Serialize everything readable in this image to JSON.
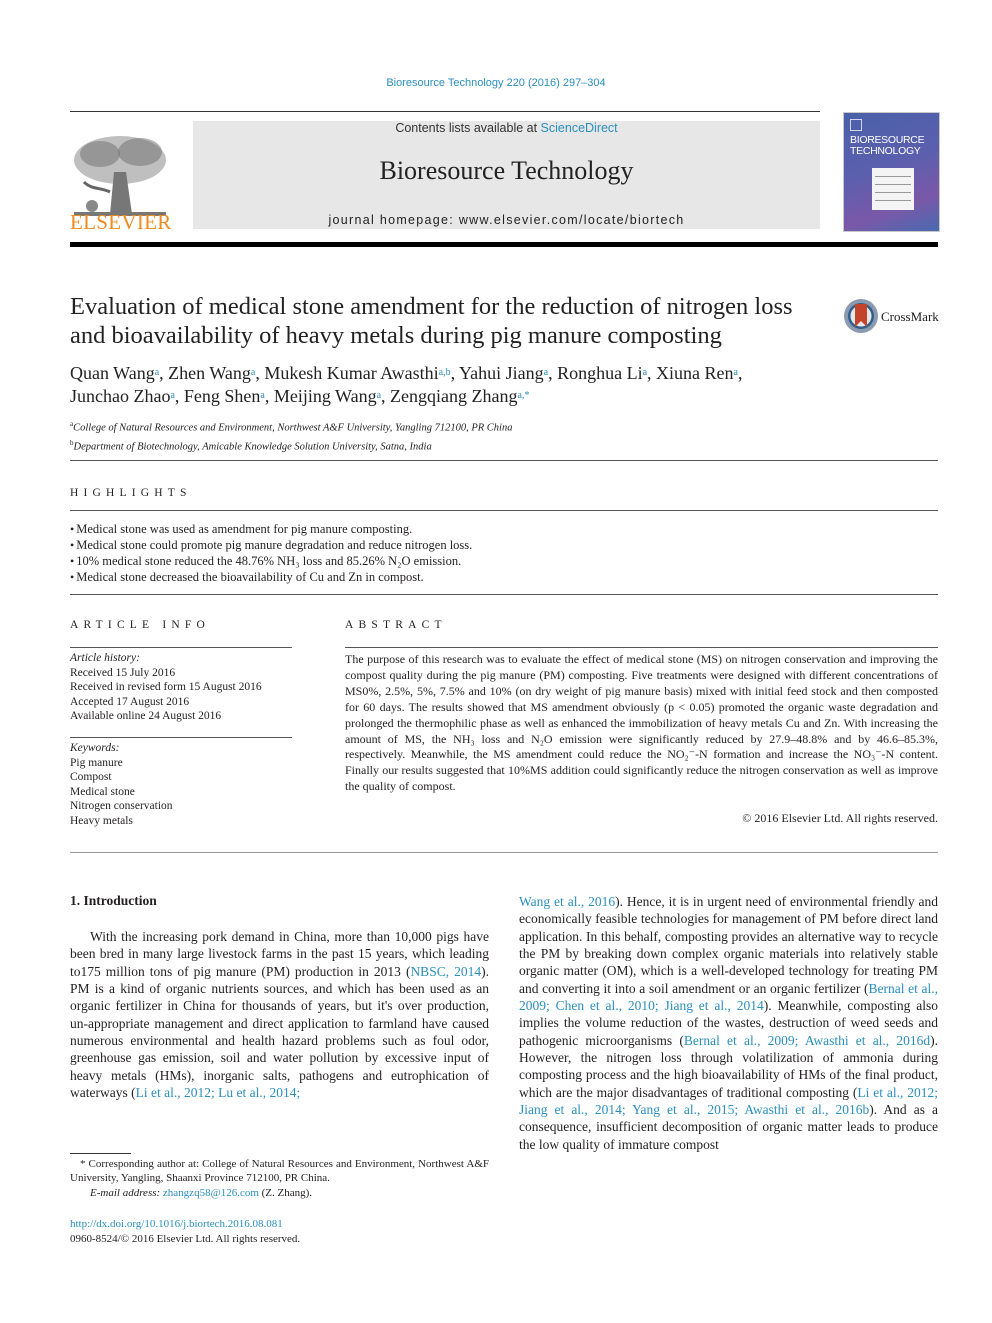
{
  "header": {
    "journal_reference": "Bioresource Technology 220 (2016) 297–304",
    "contents_prefix": "Contents lists available at ",
    "contents_link": "ScienceDirect",
    "journal_title": "Bioresource Technology",
    "homepage": "journal homepage: www.elsevier.com/locate/biortech",
    "publisher_logo_text": "ELSEVIER",
    "cover_title_line1": "BIORESOURCE",
    "cover_title_line2": "TECHNOLOGY",
    "colors": {
      "link": "#2a8fbd",
      "elsevier_orange": "#f08a1d",
      "banner_bg": "#e7e7e7"
    }
  },
  "article": {
    "title": "Evaluation of medical stone amendment for the reduction of nitrogen loss and bioavailability of heavy metals during pig manure composting",
    "crossmark_label": "CrossMark",
    "authors": [
      {
        "name": "Quan Wang",
        "aff": "a"
      },
      {
        "name": "Zhen Wang",
        "aff": "a"
      },
      {
        "name": "Mukesh Kumar Awasthi",
        "aff": "a,b"
      },
      {
        "name": "Yahui Jiang",
        "aff": "a"
      },
      {
        "name": "Ronghua Li",
        "aff": "a"
      },
      {
        "name": "Xiuna Ren",
        "aff": "a"
      },
      {
        "name": "Junchao Zhao",
        "aff": "a"
      },
      {
        "name": "Feng Shen",
        "aff": "a"
      },
      {
        "name": "Meijing Wang",
        "aff": "a"
      },
      {
        "name": "Zengqiang Zhang",
        "aff": "a,*"
      }
    ],
    "affiliations": [
      {
        "label": "a",
        "text": "College of Natural Resources and Environment, Northwest A&F University, Yangling 712100, PR China"
      },
      {
        "label": "b",
        "text": "Department of Biotechnology, Amicable Knowledge Solution University, Satna, India"
      }
    ]
  },
  "highlights": {
    "heading": "HIGHLIGHTS",
    "items": [
      "Medical stone was used as amendment for pig manure composting.",
      "Medical stone could promote pig manure degradation and reduce nitrogen loss.",
      "10% medical stone reduced the 48.76% NH₃ loss and 85.26% N₂O emission.",
      "Medical stone decreased the bioavailability of Cu and Zn in compost."
    ]
  },
  "article_info": {
    "heading": "ARTICLE INFO",
    "history_label": "Article history:",
    "history": [
      "Received 15 July 2016",
      "Received in revised form 15 August 2016",
      "Accepted 17 August 2016",
      "Available online 24 August 2016"
    ],
    "keywords_label": "Keywords:",
    "keywords": [
      "Pig manure",
      "Compost",
      "Medical stone",
      "Nitrogen conservation",
      "Heavy metals"
    ]
  },
  "abstract": {
    "heading": "ABSTRACT",
    "text": "The purpose of this research was to evaluate the effect of medical stone (MS) on nitrogen conservation and improving the compost quality during the pig manure (PM) composting. Five treatments were designed with different concentrations of MS0%, 2.5%, 5%, 7.5% and 10% (on dry weight of pig manure basis) mixed with initial feed stock and then composted for 60 days. The results showed that MS amendment obviously (p < 0.05) promoted the organic waste degradation and prolonged the thermophilic phase as well as enhanced the immobilization of heavy metals Cu and Zn. With increasing the amount of MS, the NH₃ loss and N₂O emission were significantly reduced by 27.9–48.8% and by 46.6–85.3%, respectively. Meanwhile, the MS amendment could reduce the NO₂⁻-N formation and increase the NO₃⁻-N content. Finally our results suggested that 10%MS addition could significantly reduce the nitrogen conservation as well as improve the quality of compost.",
    "copyright": "© 2016 Elsevier Ltd. All rights reserved."
  },
  "introduction": {
    "heading": "1. Introduction",
    "col1_p1": "With the increasing pork demand in China, more than 10,000 pigs have been bred in many large livestock farms in the past 15 years, which leading to175 million tons of pig manure (PM) production in 2013 (",
    "cite_nbsc": "NBSC, 2014",
    "col1_p2": "). PM is a kind of organic nutrients sources, and which has been used as an organic fertilizer in China for thousands of years, but it's over production, un-appropriate management and direct application to farmland have caused numerous environmental and health hazard problems such as foul odor, greenhouse gas emission, soil and water pollution by excessive input of heavy metals (HMs), inorganic salts, pathogens and eutrophication of waterways (",
    "cite_li_lu": "Li et al., 2012; Lu et al., 2014;",
    "cite_wang": "Wang et al., 2016",
    "col2_p1": "). Hence, it is in urgent need of environmental friendly and economically feasible technologies for management of PM before direct land application. In this behalf, composting provides an alternative way to recycle the PM by breaking down complex organic materials into relatively stable organic matter (OM), which is a well-developed technology for treating PM and converting it into a soil amendment or an organic fertilizer (",
    "cite_bernal_chen_jiang": "Bernal et al., 2009; Chen et al., 2010; Jiang et al., 2014",
    "col2_p2": "). Meanwhile, composting also implies the volume reduction of the wastes, destruction of weed seeds and pathogenic microorganisms (",
    "cite_bernal_awasthi": "Bernal et al., 2009; Awasthi et al., 2016d",
    "col2_p3": "). However, the nitrogen loss through volatilization of ammonia during composting process and the high bioavailability of HMs of the final product, which are the major disadvantages of traditional composting (",
    "cite_li_jiang_yang_awasthi": "Li et al., 2012; Jiang et al., 2014; Yang et al., 2015; Awasthi et al., 2016b",
    "col2_p4": "). And as a consequence, insufficient decomposition of organic matter leads to produce the low quality of immature compost"
  },
  "footnote": {
    "corresponding": "* Corresponding author at: College of Natural Resources and Environment, Northwest A&F University, Yangling, Shaanxi Province 712100, PR China.",
    "email_label": "E-mail address: ",
    "email": "zhangzq58@126.com",
    "email_suffix": " (Z. Zhang).",
    "doi": "http://dx.doi.org/10.1016/j.biortech.2016.08.081",
    "issn": "0960-8524/© 2016 Elsevier Ltd. All rights reserved."
  }
}
